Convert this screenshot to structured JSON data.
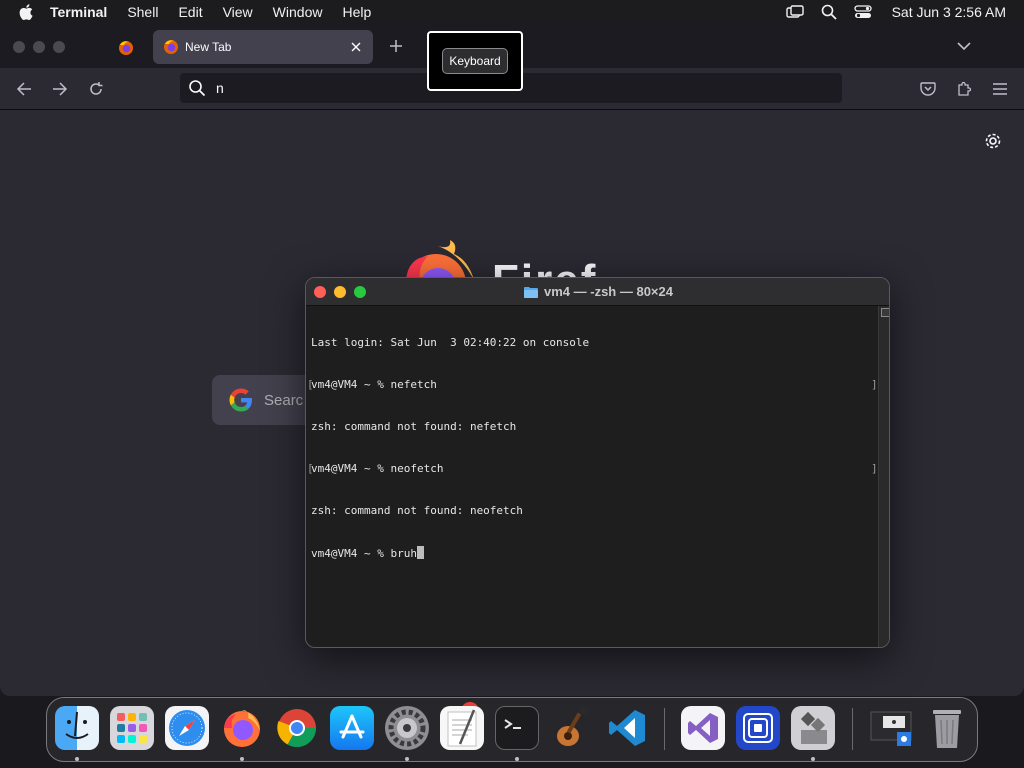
{
  "menubar": {
    "app_name": "Terminal",
    "items": [
      "Shell",
      "Edit",
      "View",
      "Window",
      "Help"
    ],
    "clock": "Sat Jun 3  2:56 AM"
  },
  "firefox": {
    "tab_title": "New Tab",
    "url_value": "n",
    "wordmark": "Firef",
    "google_search_placeholder": "Searc"
  },
  "tooltip": {
    "text": "Keyboard"
  },
  "terminal": {
    "title": "vm4 — -zsh — 80×24",
    "lines": [
      "Last login: Sat Jun  3 02:40:22 on console",
      "vm4@VM4 ~ % nefetch",
      "zsh: command not found: nefetch",
      "vm4@VM4 ~ % neofetch",
      "zsh: command not found: neofetch",
      "vm4@VM4 ~ % bruh"
    ]
  },
  "dock": {
    "settings_badge": "1",
    "apps": [
      "finder",
      "launchpad",
      "safari",
      "firefox",
      "chrome",
      "app-store",
      "system-settings",
      "textedit",
      "terminal",
      "garageband",
      "vscode",
      "visual-studio",
      "simulator",
      "boot-camp",
      "display-manager",
      "trash"
    ]
  },
  "colors": {
    "terminal_bg": "#1e1e1e",
    "firefox_bg": "#2b2a33",
    "traffic_red": "#ff5f57",
    "traffic_yellow": "#febc2e",
    "traffic_green": "#28c840"
  }
}
